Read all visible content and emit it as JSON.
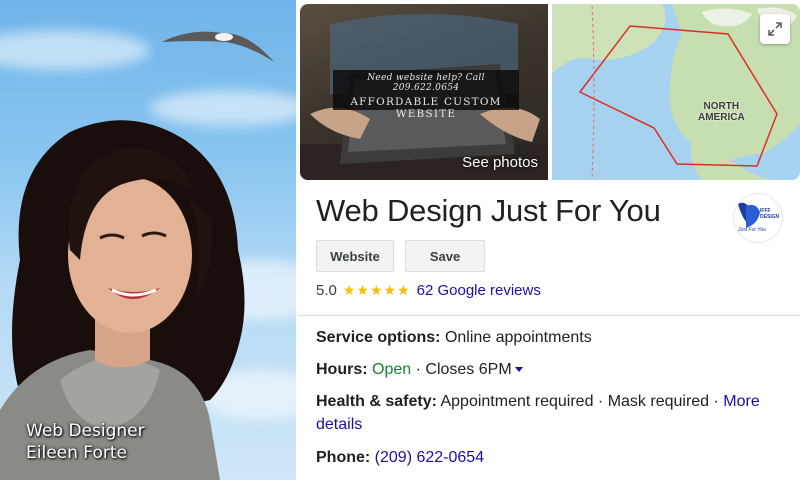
{
  "portrait": {
    "caption_line1": "Web Designer",
    "caption_line2": "Eileen Forte"
  },
  "photo": {
    "sign_line1": "Need website help? Call 209.622.0654",
    "sign_line2": "AFFORDABLE CUSTOM WEBSITE",
    "see_photos_label": "See photos"
  },
  "map": {
    "region_label_line1": "NORTH",
    "region_label_line2": "AMERICA",
    "expand_icon": "expand-icon"
  },
  "business": {
    "name": "Web Design Just For You",
    "logo_text_line1": "IFFF",
    "logo_text_line2": "DESIGN",
    "logo_text_line3": "Just For You"
  },
  "actions": {
    "website_label": "Website",
    "save_label": "Save"
  },
  "rating": {
    "score": "5.0",
    "stars": "★★★★★",
    "reviews_label": "62 Google reviews"
  },
  "info": {
    "service_label": "Service options:",
    "service_value": "Online appointments",
    "hours_label": "Hours:",
    "hours_status": "Open",
    "hours_sep": "·",
    "hours_value": "Closes 6PM",
    "health_label": "Health & safety:",
    "health_value": "Appointment required · Mask required ·",
    "health_more_part1": "More",
    "health_more_part2": "details",
    "phone_label": "Phone:",
    "phone_value": "(209) 622-0654"
  },
  "colors": {
    "link": "#1a0dab",
    "open": "#188038",
    "star": "#fbbc04",
    "sky": "#8cc6f0"
  }
}
